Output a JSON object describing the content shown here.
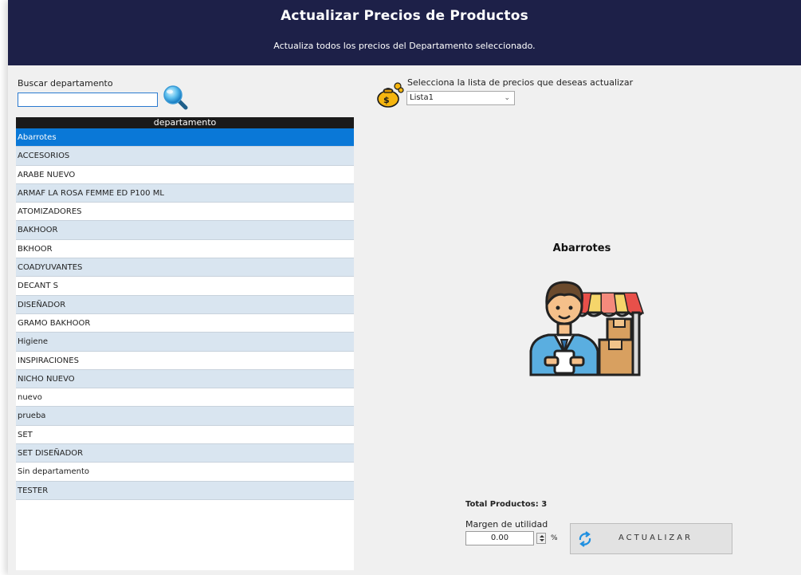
{
  "header": {
    "title": "Actualizar Precios de Productos",
    "subtitle": "Actualiza todos los precios del Departamento seleccionado."
  },
  "search": {
    "label": "Buscar departamento",
    "value": "",
    "icon": "magnifier-icon"
  },
  "departments": {
    "column_header": "departamento",
    "selected_index": 0,
    "items": [
      "Abarrotes",
      "ACCESORIOS",
      "ARABE NUEVO",
      "ARMAF LA ROSA FEMME ED P100 ML",
      "ATOMIZADORES",
      "BAKHOOR",
      "BKHOOR",
      "COADYUVANTES",
      "DECANT S",
      "DISEÑADOR",
      "GRAMO BAKHOOR",
      "Higiene",
      "INSPIRACIONES",
      "NICHO NUEVO",
      "nuevo",
      "prueba",
      "SET",
      "SET DISEÑADOR",
      "Sin departamento",
      "TESTER"
    ]
  },
  "price_list": {
    "label": "Selecciona la lista de precios que deseas actualizar",
    "selected": "Lista1",
    "icon": "money-bag-icon"
  },
  "preview": {
    "department_name": "Abarrotes",
    "illustration": "shopkeeper-store-illustration"
  },
  "summary": {
    "total_products": "Total Productos: 3"
  },
  "margin": {
    "label": "Margen de utilidad",
    "value": "0.00",
    "unit": "%"
  },
  "update_button": {
    "label": "ACTUALIZAR",
    "icon": "refresh-icon"
  },
  "colors": {
    "header_bg": "#1d2048",
    "selected_row": "#0a78d7",
    "alt_row": "#d9e5f0"
  }
}
